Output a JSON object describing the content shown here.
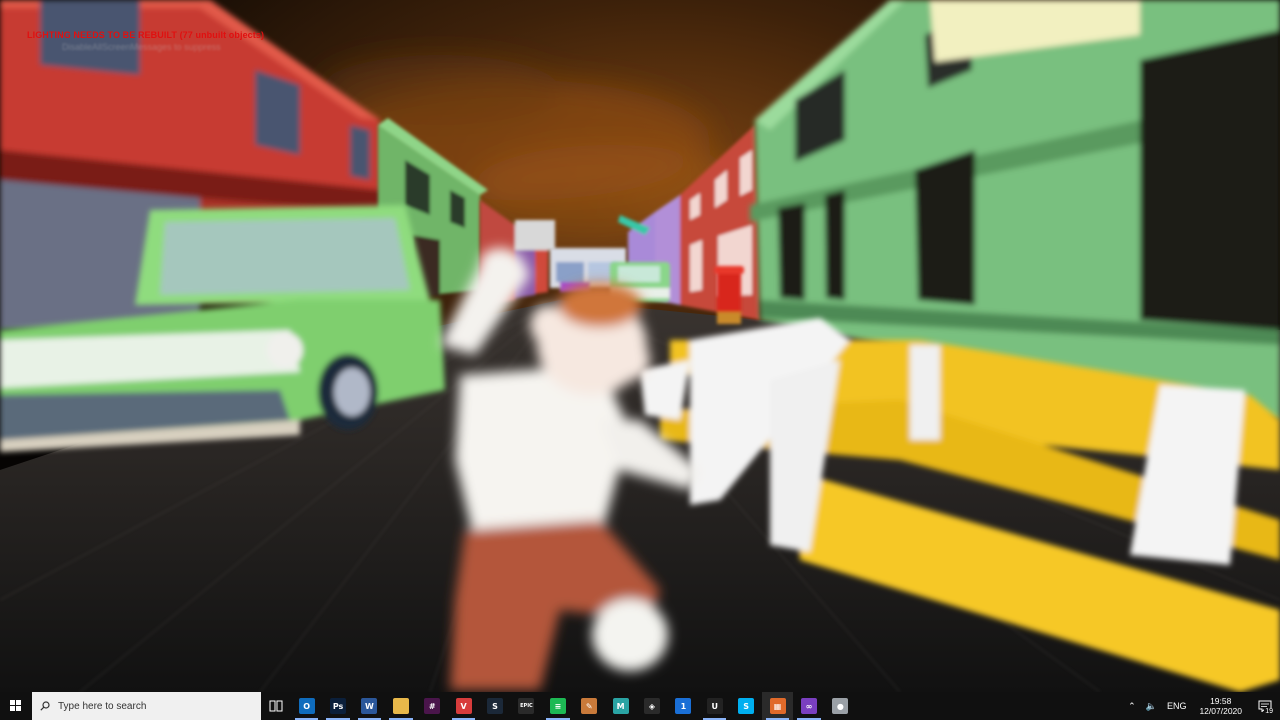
{
  "game": {
    "debug_message": "LIGHTING NEEDS TO BE REBUILT (77 unbuilt objects)",
    "debug_submessage": "DisableAllScreenMessages to suppress"
  },
  "taskbar": {
    "search_placeholder": "Type here to search",
    "apps": [
      {
        "name": "outlook",
        "icon": "outlook-icon",
        "glyph": "O",
        "color": "#0f6cbd",
        "running": true
      },
      {
        "name": "photoshop",
        "icon": "photoshop-icon",
        "glyph": "Ps",
        "color": "#0b1f3a",
        "running": true
      },
      {
        "name": "word",
        "icon": "word-icon",
        "glyph": "W",
        "color": "#2b579a",
        "running": true
      },
      {
        "name": "file-explorer",
        "icon": "folder-icon",
        "glyph": "",
        "color": "#e8b84a",
        "running": true
      },
      {
        "name": "slack",
        "icon": "slack-icon",
        "glyph": "#",
        "color": "#4a154b",
        "running": false
      },
      {
        "name": "vivaldi",
        "icon": "vivaldi-icon",
        "glyph": "V",
        "color": "#d83c3c",
        "running": true
      },
      {
        "name": "steam",
        "icon": "steam-icon",
        "glyph": "S",
        "color": "#1b2838",
        "running": false
      },
      {
        "name": "epic-games",
        "icon": "epic-games-icon",
        "glyph": "EPIC",
        "color": "#2a2a2a",
        "running": false
      },
      {
        "name": "spotify",
        "icon": "spotify-icon",
        "glyph": "≡",
        "color": "#1db954",
        "running": true
      },
      {
        "name": "paint-app",
        "icon": "paint-icon",
        "glyph": "✎",
        "color": "#c97a3a",
        "running": false
      },
      {
        "name": "maya",
        "icon": "maya-icon",
        "glyph": "M",
        "color": "#2aa4a4",
        "running": false
      },
      {
        "name": "unity",
        "icon": "unity-icon",
        "glyph": "◈",
        "color": "#2a2a2a",
        "running": false
      },
      {
        "name": "onepassword",
        "icon": "onepassword-icon",
        "glyph": "1",
        "color": "#1a6fd6",
        "running": false
      },
      {
        "name": "unreal-engine",
        "icon": "unreal-engine-icon",
        "glyph": "U",
        "color": "#222",
        "running": true
      },
      {
        "name": "skype",
        "icon": "skype-icon",
        "glyph": "S",
        "color": "#00aff0",
        "running": false
      },
      {
        "name": "game-window",
        "icon": "game-window-icon",
        "glyph": "▦",
        "color": "#e06a2a",
        "running": true,
        "active": true
      },
      {
        "name": "visual-studio",
        "icon": "visual-studio-icon",
        "glyph": "∞",
        "color": "#7a3fc0",
        "running": true
      },
      {
        "name": "extra-app",
        "icon": "shield-app-icon",
        "glyph": "●",
        "color": "#9aa0a6",
        "running": false
      }
    ],
    "tray": {
      "language": "ENG",
      "time": "19:58",
      "date": "12/07/2020",
      "notification_count": "19"
    }
  }
}
